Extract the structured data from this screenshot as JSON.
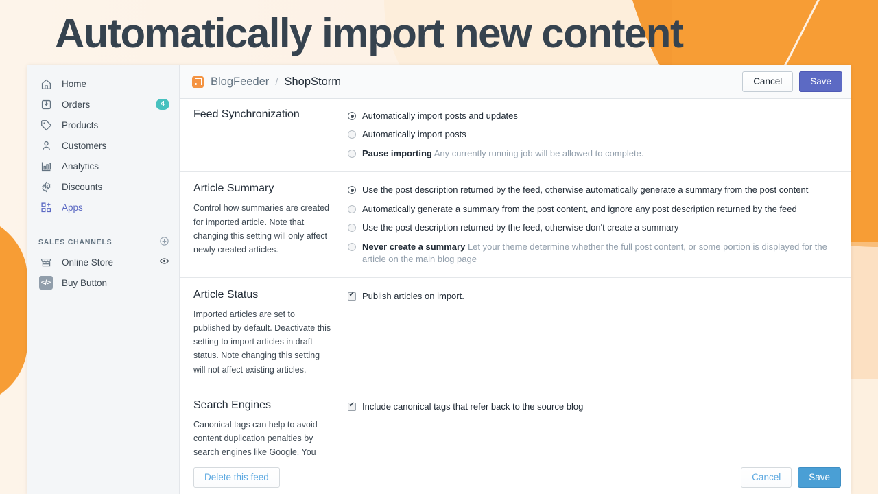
{
  "headline": "Automatically import new content",
  "sidebar": {
    "items": [
      {
        "label": "Home",
        "icon": "home-icon",
        "badge": null,
        "active": false
      },
      {
        "label": "Orders",
        "icon": "orders-inbox-icon",
        "badge": "4",
        "active": false
      },
      {
        "label": "Products",
        "icon": "tag-icon",
        "badge": null,
        "active": false
      },
      {
        "label": "Customers",
        "icon": "person-icon",
        "badge": null,
        "active": false
      },
      {
        "label": "Analytics",
        "icon": "bar-chart-icon",
        "badge": null,
        "active": false
      },
      {
        "label": "Discounts",
        "icon": "discount-badge-icon",
        "badge": null,
        "active": false
      },
      {
        "label": "Apps",
        "icon": "apps-grid-plus-icon",
        "badge": null,
        "active": true
      }
    ],
    "section_title": "SALES CHANNELS",
    "add_channel_icon": "plus-circle-icon",
    "channels": [
      {
        "label": "Online Store",
        "icon": "storefront-icon",
        "trailing_icon": "eye-icon"
      },
      {
        "label": "Buy Button",
        "icon": "code-tag-icon",
        "trailing_icon": null
      }
    ]
  },
  "topbar": {
    "app_icon": "rss-feed-icon",
    "app_name": "BlogFeeder",
    "separator": "/",
    "store_name": "ShopStorm",
    "cancel_label": "Cancel",
    "save_label": "Save"
  },
  "sections": [
    {
      "title": "Feed Synchronization",
      "description": "",
      "control_type": "radio",
      "options": [
        {
          "label": "Automatically import posts and updates",
          "help": "",
          "selected": true
        },
        {
          "label": "Automatically import posts",
          "help": "",
          "selected": false
        },
        {
          "label": "Pause importing",
          "help": "Any currently running job will be allowed to complete.",
          "selected": false,
          "bold_label": true
        }
      ]
    },
    {
      "title": "Article Summary",
      "description": "Control how summaries are created for imported article. Note that changing this setting will only affect newly created articles.",
      "control_type": "radio",
      "options": [
        {
          "label": "Use the post description returned by the feed, otherwise automatically generate a summary from the post content",
          "help": "",
          "selected": true
        },
        {
          "label": "Automatically generate a summary from the post content, and ignore any post description returned by the feed",
          "help": "",
          "selected": false
        },
        {
          "label": "Use the post description returned by the feed, otherwise don't create a summary",
          "help": "",
          "selected": false
        },
        {
          "label": "Never create a summary",
          "help": "Let your theme determine whether the full post content, or some portion is displayed for the article on the main blog page",
          "selected": false,
          "bold_label": true
        }
      ]
    },
    {
      "title": "Article Status",
      "description": "Imported articles are set to published by default. Deactivate this setting to import articles in draft status. Note changing this setting will not affect existing articles.",
      "control_type": "checkbox",
      "options": [
        {
          "label": "Publish articles on import.",
          "help": "",
          "selected": true
        }
      ]
    },
    {
      "title": "Search Engines",
      "description": "Canonical tags can help to avoid content duplication penalties by search engines like Google. You should enable this if you get traffic to your source blog.",
      "control_type": "checkbox",
      "options": [
        {
          "label": "Include canonical tags that refer back to the source blog",
          "help": "",
          "selected": true
        }
      ]
    }
  ],
  "footer": {
    "delete_label": "Delete this feed",
    "cancel_label": "Cancel",
    "save_label": "Save"
  },
  "colors": {
    "accent_orange": "#f59a33",
    "headline": "#36434f",
    "indigo": "#5c6ac4",
    "blue": "#4a9fd5",
    "teal_badge": "#47c1bf"
  }
}
